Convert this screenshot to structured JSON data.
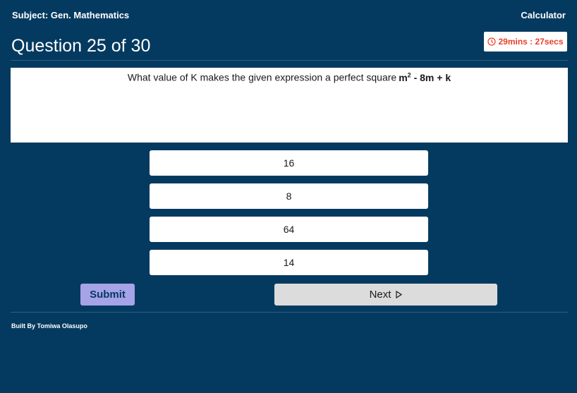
{
  "header": {
    "subject": "Subject: Gen. Mathematics",
    "calculator_label": "Calculator"
  },
  "question": {
    "title": "Question 25 of 30",
    "text": "What value of K makes the given expression a perfect square",
    "expr_base": "m",
    "expr_exp": "2",
    "expr_rest": " - 8m + k"
  },
  "timer": {
    "label": "29mins : 27secs",
    "icon": "clock-icon",
    "color": "#e8402a"
  },
  "options": [
    "16",
    "8",
    "64",
    "14"
  ],
  "actions": {
    "submit_label": "Submit",
    "next_label": "Next",
    "next_icon": "play-triangle-icon"
  },
  "footer": {
    "text": "Built By Tomiwa Olasupo"
  },
  "colors": {
    "background": "#053a60",
    "submit": "#a6a3e8",
    "next": "#dcdcdc"
  }
}
